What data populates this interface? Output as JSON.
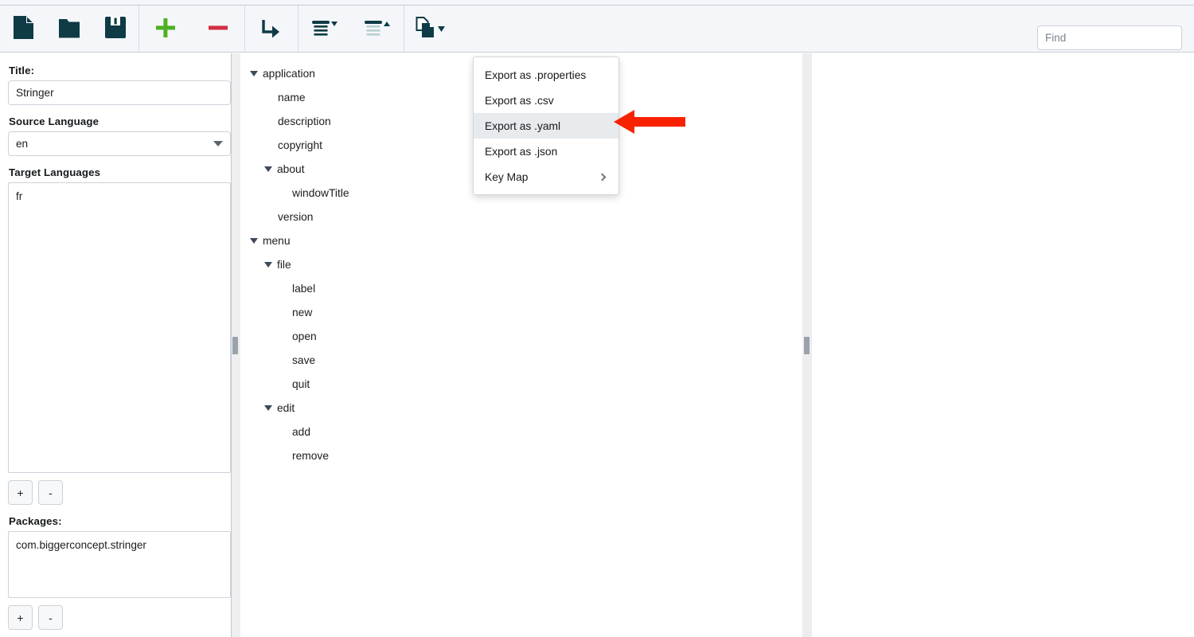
{
  "app": {
    "title": "Stringer"
  },
  "toolbar": {
    "buttons": [
      {
        "name": "new-file",
        "icon": "new-document-icon",
        "label": "New"
      },
      {
        "name": "open-folder",
        "icon": "open-folder-icon",
        "label": "Open"
      },
      {
        "name": "save",
        "icon": "save-floppy-icon",
        "label": "Save"
      },
      {
        "name": "add",
        "icon": "plus-icon",
        "label": "Add"
      },
      {
        "name": "remove",
        "icon": "minus-icon",
        "label": "Remove"
      },
      {
        "name": "translate",
        "icon": "arrow-turn-right-icon",
        "label": "Translate"
      },
      {
        "name": "expand-all",
        "icon": "expand-all-icon",
        "label": "Expand All"
      },
      {
        "name": "collapse-all",
        "icon": "collapse-all-icon",
        "label": "Collapse All"
      },
      {
        "name": "export",
        "icon": "export-documents-icon",
        "label": "Export"
      }
    ],
    "search": {
      "placeholder": "Find",
      "value": ""
    },
    "colors": {
      "icon_dark": "#0e3b45",
      "add_green": "#4cb122",
      "remove_red": "#d32f44",
      "background": "#f4f6f9"
    }
  },
  "sidebar": {
    "title_label": "Title:",
    "title_value": "Stringer",
    "source_language_label": "Source Language",
    "source_language_value": "en",
    "target_languages_label": "Target Languages",
    "target_languages": [
      "fr"
    ],
    "target_add_label": "+",
    "target_remove_label": "-",
    "packages_label": "Packages:",
    "packages": [
      "com.biggerconcept.stringer"
    ],
    "packages_add_label": "+",
    "packages_remove_label": "-"
  },
  "tree": {
    "nodes": [
      {
        "label": "application",
        "depth": 0,
        "expanded": true
      },
      {
        "label": "name",
        "depth": 1,
        "expanded": null
      },
      {
        "label": "description",
        "depth": 1,
        "expanded": null
      },
      {
        "label": "copyright",
        "depth": 1,
        "expanded": null
      },
      {
        "label": "about",
        "depth": 1,
        "expanded": true
      },
      {
        "label": "windowTitle",
        "depth": 2,
        "expanded": null
      },
      {
        "label": "version",
        "depth": 1,
        "expanded": null
      },
      {
        "label": "menu",
        "depth": 0,
        "expanded": true
      },
      {
        "label": "file",
        "depth": 1,
        "expanded": true
      },
      {
        "label": "label",
        "depth": 2,
        "expanded": null
      },
      {
        "label": "new",
        "depth": 2,
        "expanded": null
      },
      {
        "label": "open",
        "depth": 2,
        "expanded": null
      },
      {
        "label": "save",
        "depth": 2,
        "expanded": null
      },
      {
        "label": "quit",
        "depth": 2,
        "expanded": null
      },
      {
        "label": "edit",
        "depth": 1,
        "expanded": true
      },
      {
        "label": "add",
        "depth": 2,
        "expanded": null
      },
      {
        "label": "remove",
        "depth": 2,
        "expanded": null
      }
    ]
  },
  "export_menu": {
    "items": [
      {
        "label": "Export as .properties",
        "active": false,
        "submenu": false
      },
      {
        "label": "Export as .csv",
        "active": false,
        "submenu": false
      },
      {
        "label": "Export as .yaml",
        "active": true,
        "submenu": false
      },
      {
        "label": "Export as .json",
        "active": false,
        "submenu": false
      },
      {
        "label": "Key Map",
        "active": false,
        "submenu": true
      }
    ]
  },
  "annotation": {
    "arrow_color": "#f92200",
    "points_to": "Export as .yaml"
  }
}
